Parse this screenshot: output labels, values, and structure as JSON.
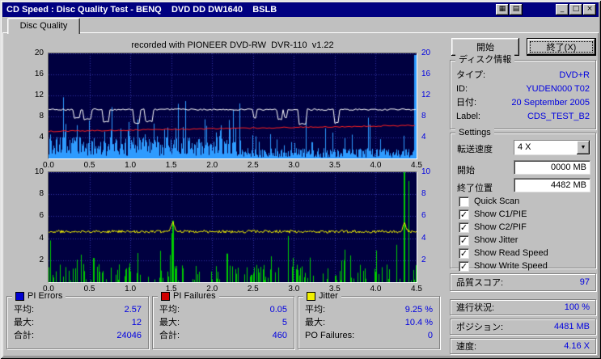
{
  "window": {
    "title": "CD Speed : Disc Quality Test - BENQ    DVD DD DW1640    BSLB"
  },
  "icons": {
    "tool1": "▦",
    "tool2": "▤",
    "minimize": "_",
    "maximize": "□",
    "close": "×",
    "dropdown": "▼"
  },
  "tab": {
    "label": "Disc Quality"
  },
  "buttons": {
    "start": "開始",
    "exit": "終了(X)"
  },
  "disc_info": {
    "title": "ディスク情報",
    "rows": [
      {
        "label": "タイプ:",
        "value": "DVD+R"
      },
      {
        "label": "ID:",
        "value": "YUDEN000 T02"
      },
      {
        "label": "日付:",
        "value": "20 September 2005"
      },
      {
        "label": "Label:",
        "value": "CDS_TEST_B2"
      }
    ]
  },
  "settings": {
    "title": "Settings",
    "transfer_label": "転送速度",
    "transfer_value": "4 X",
    "start_label": "開始",
    "start_value": "0000 MB",
    "end_label": "終了位置",
    "end_value": "4482 MB",
    "checkboxes": [
      {
        "label": "Quick Scan",
        "checked": false
      },
      {
        "label": "Show C1/PIE",
        "checked": true
      },
      {
        "label": "Show C2/PIF",
        "checked": true
      },
      {
        "label": "Show Jitter",
        "checked": true
      },
      {
        "label": "Show Read Speed",
        "checked": true
      },
      {
        "label": "Show Write Speed",
        "checked": true
      }
    ]
  },
  "quality": {
    "label": "品質スコア:",
    "value": "97"
  },
  "status": [
    {
      "label": "進行状況:",
      "value": "100 %"
    },
    {
      "label": "ポジション:",
      "value": "4481 MB"
    },
    {
      "label": "速度:",
      "value": "4.16 X"
    }
  ],
  "stats": [
    {
      "title": "PI Errors",
      "color": "#0000d0",
      "rows": [
        {
          "label": "平均:",
          "value": "2.57"
        },
        {
          "label": "最大:",
          "value": "12"
        },
        {
          "label": "合計:",
          "value": "24046"
        }
      ]
    },
    {
      "title": "PI Failures",
      "color": "#d00000",
      "rows": [
        {
          "label": "平均:",
          "value": "0.05"
        },
        {
          "label": "最大:",
          "value": "5"
        },
        {
          "label": "合計:",
          "value": "460"
        }
      ]
    },
    {
      "title": "Jitter",
      "color": "#f0f000",
      "rows": [
        {
          "label": "平均:",
          "value": "9.25 %"
        },
        {
          "label": "最大:",
          "value": "10.4 %"
        },
        {
          "label": "PO Failures:",
          "value": "0"
        }
      ]
    }
  ],
  "chart_data": [
    {
      "type": "line",
      "title": "recorded with PIONEER DVD-RW  DVR-110  v1.22",
      "xlim": [
        0,
        4.5
      ],
      "x_ticks": [
        0,
        0.5,
        1,
        1.5,
        2,
        2.5,
        3,
        3.5,
        4,
        4.5
      ],
      "ylim": [
        0,
        20
      ],
      "y_ticks": [
        4,
        8,
        12,
        16,
        20
      ],
      "background": "#000040",
      "grid_color": "#3434a8",
      "series": [
        {
          "name": "PI Errors (C1/PIE)",
          "type": "spikes",
          "color": "#2E9BFF",
          "average": 2.57,
          "max": 12
        },
        {
          "name": "Read Speed",
          "type": "line",
          "color": "#FFFFFF",
          "approx_level": 9.3
        },
        {
          "name": "Write Speed",
          "type": "line",
          "color": "#FF2020",
          "start_level": 5.15,
          "end_level": 6.3
        }
      ]
    },
    {
      "type": "line",
      "xlim": [
        0,
        4.5
      ],
      "x_ticks": [
        0,
        0.5,
        1,
        1.5,
        2,
        2.5,
        3,
        3.5,
        4,
        4.5
      ],
      "ylim": [
        0,
        10
      ],
      "y_ticks": [
        2,
        4,
        6,
        8,
        10
      ],
      "background": "#000040",
      "grid_color": "#3434a8",
      "series": [
        {
          "name": "PI Failures (C2/PIF)",
          "type": "spikes",
          "color": "#00CC00",
          "average": 0.05,
          "max": 5
        },
        {
          "name": "Jitter",
          "type": "line",
          "color": "#F0F000",
          "approx_level": 4.6,
          "average_pct": "9.25 %",
          "max_pct": "10.4 %"
        }
      ]
    }
  ]
}
